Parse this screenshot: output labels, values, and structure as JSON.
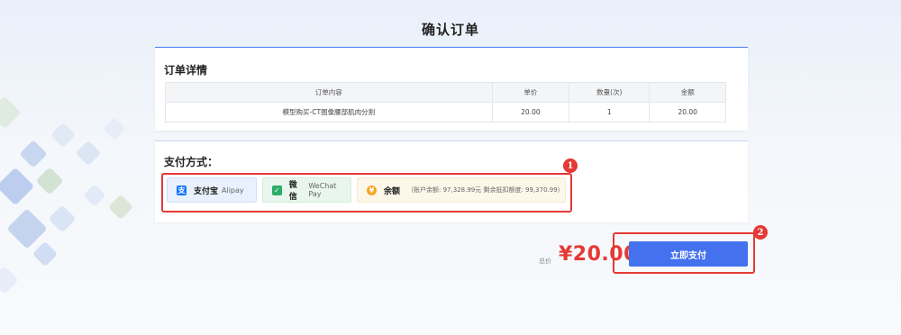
{
  "page": {
    "title": "确认订单"
  },
  "order_section": {
    "title": "订单详情",
    "columns": [
      "订单内容",
      "单价",
      "数量(次)",
      "金额"
    ],
    "rows": [
      {
        "content": "模型购买-CT图像腰部肌肉分割",
        "unit_price": "20.00",
        "quantity": "1",
        "amount": "20.00"
      }
    ]
  },
  "payment_section": {
    "title": "支付方式：",
    "options": [
      {
        "name": "支付宝",
        "en": "Alipay",
        "icon": "alipay-icon",
        "color": "#1677ff"
      },
      {
        "name": "微信",
        "en": "WeChat Pay",
        "icon": "wechat-icon",
        "color": "#2aae67"
      },
      {
        "name": "余额",
        "note": "（账户余额: 97,328.99元 剩余抵扣额度: 99,370.99）",
        "icon": "coin-icon",
        "color": "#f5a623"
      }
    ]
  },
  "summary": {
    "total_label": "总价",
    "total_amount": "¥20.00",
    "pay_button": "立即支付"
  },
  "annotations": [
    "1",
    "2"
  ],
  "colors": {
    "accent": "#4472ee",
    "price": "#e53935",
    "annotation": "#e53935"
  }
}
